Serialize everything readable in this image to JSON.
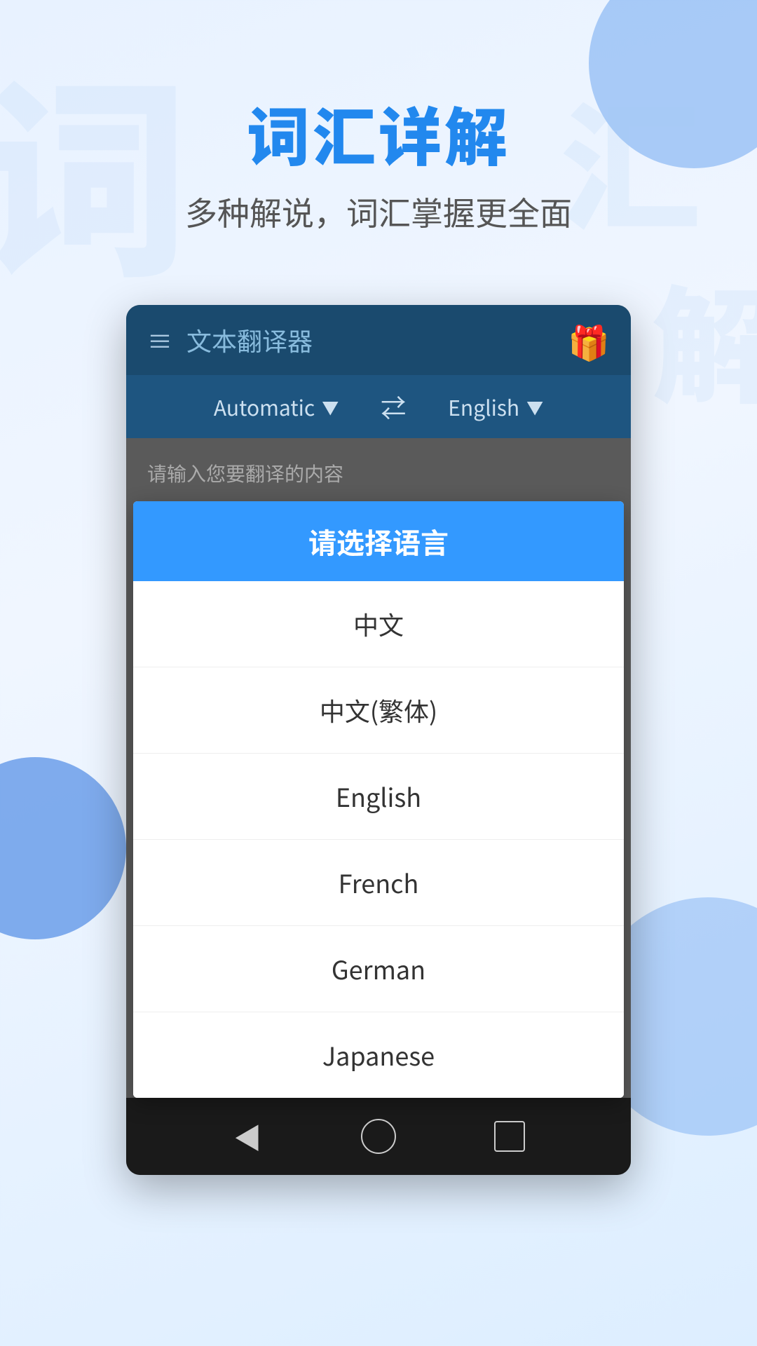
{
  "background": {
    "watermark1": "词",
    "watermark2": "汇",
    "watermark3": "解"
  },
  "header": {
    "title": "词汇详解",
    "subtitle": "多种解说，词汇掌握更全面"
  },
  "toolbar": {
    "app_title": "文本翻译器",
    "gift_icon": "🎁"
  },
  "language_bar": {
    "source_lang": "Automatic",
    "target_lang": "English",
    "swap_symbol": "⇄"
  },
  "input_area": {
    "placeholder": "请输入您要翻译的内容"
  },
  "dialog": {
    "title": "请选择语言",
    "options": [
      {
        "id": "zh",
        "label": "中文"
      },
      {
        "id": "zh-tw",
        "label": "中文(繁体)"
      },
      {
        "id": "en",
        "label": "English"
      },
      {
        "id": "fr",
        "label": "French"
      },
      {
        "id": "de",
        "label": "German"
      },
      {
        "id": "ja",
        "label": "Japanese"
      }
    ]
  },
  "bottom_nav": {
    "back_label": "◀",
    "home_label": "",
    "recent_label": ""
  }
}
